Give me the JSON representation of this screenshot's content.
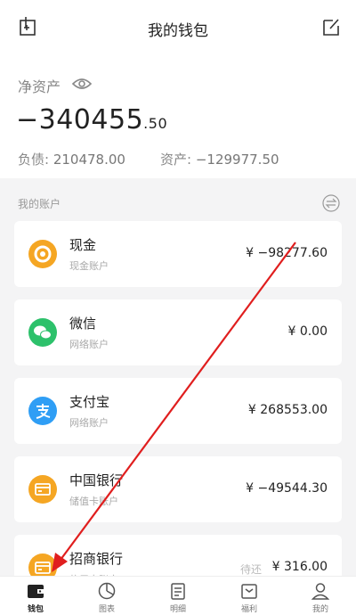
{
  "header": {
    "title": "我的钱包",
    "left_icon": "add-square-icon",
    "right_icon": "edit-icon"
  },
  "summary": {
    "net_label": "净资产",
    "net_value_int": "−340455",
    "net_value_dec": ".50",
    "debt_label": "负债:",
    "debt_value": "210478.00",
    "asset_label": "资产:",
    "asset_value": "−129977.50"
  },
  "accounts": {
    "section_title": "我的账户",
    "items": [
      {
        "name": "现金",
        "type": "现金账户",
        "amount": "¥ −98277.60",
        "icon": "cash-icon",
        "color": "#f5a623"
      },
      {
        "name": "微信",
        "type": "网络账户",
        "amount": "¥ 0.00",
        "icon": "wechat-icon",
        "color": "#2dc16b"
      },
      {
        "name": "支付宝",
        "type": "网络账户",
        "amount": "¥ 268553.00",
        "icon": "alipay-icon",
        "color": "#2f9ef5"
      },
      {
        "name": "中国银行",
        "type": "储值卡账户",
        "amount": "¥ −49544.30",
        "icon": "bank-card-icon",
        "color": "#f5a623"
      },
      {
        "name": "招商银行",
        "type": "信用卡账户",
        "amount": "¥ 316.00",
        "pending": "待还",
        "icon": "credit-card-icon",
        "color": "#f5a623"
      }
    ]
  },
  "tabbar": {
    "tabs": [
      {
        "label": "钱包",
        "icon": "wallet-icon",
        "active": true
      },
      {
        "label": "图表",
        "icon": "pie-chart-icon",
        "active": false
      },
      {
        "label": "明细",
        "icon": "list-detail-icon",
        "active": false
      },
      {
        "label": "福利",
        "icon": "gift-box-icon",
        "active": false
      },
      {
        "label": "我的",
        "icon": "user-icon",
        "active": false
      }
    ]
  },
  "annotation": {
    "color": "#e01e1e"
  }
}
